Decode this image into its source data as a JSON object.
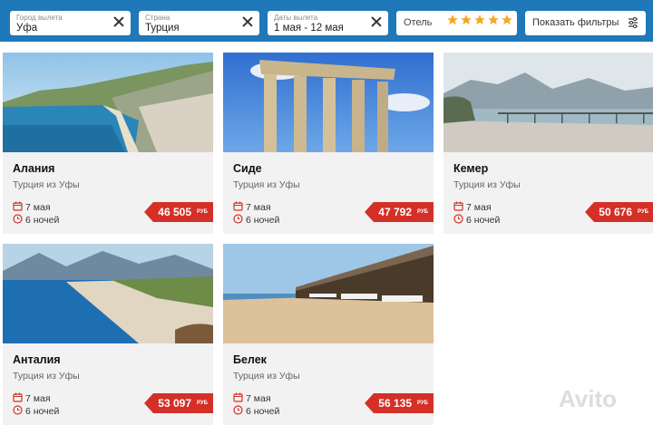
{
  "filters": {
    "city": {
      "label": "Город вылета",
      "value": "Уфа"
    },
    "country": {
      "label": "Страна",
      "value": "Турция"
    },
    "dates": {
      "label": "Даты вылета",
      "value": "1 мая - 12 мая"
    },
    "hotel": {
      "label": "Отель",
      "stars": 5,
      "star_color": "#f5a623"
    },
    "more_label": "Показать фильтры"
  },
  "colors": {
    "header": "#1f78b8",
    "price_tag": "#d43027",
    "icon_red": "#d43027"
  },
  "tours": [
    {
      "city": "Алания",
      "origin": "Турция из Уфы",
      "date": "7 мая",
      "nights": "6 ночей",
      "price": "46 505",
      "currency": "РУБ"
    },
    {
      "city": "Сиде",
      "origin": "Турция из Уфы",
      "date": "7 мая",
      "nights": "6 ночей",
      "price": "47 792",
      "currency": "РУБ"
    },
    {
      "city": "Кемер",
      "origin": "Турция из Уфы",
      "date": "7 мая",
      "nights": "6 ночей",
      "price": "50 676",
      "currency": "РУБ"
    },
    {
      "city": "Анталия",
      "origin": "Турция из Уфы",
      "date": "7 мая",
      "nights": "6 ночей",
      "price": "53 097",
      "currency": "РУБ"
    },
    {
      "city": "Белек",
      "origin": "Турция из Уфы",
      "date": "7 мая",
      "nights": "6 ночей",
      "price": "56 135",
      "currency": "РУБ"
    }
  ],
  "watermark": "Avito"
}
